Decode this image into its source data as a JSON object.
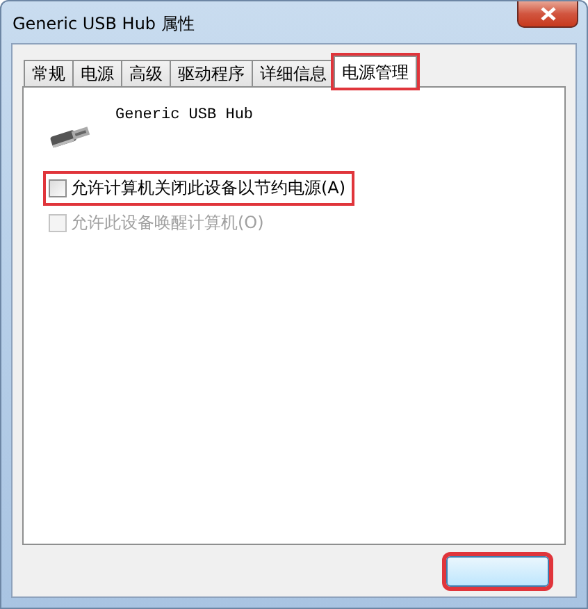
{
  "window": {
    "title": "Generic USB Hub 属性"
  },
  "tabs": [
    {
      "label": "常规",
      "selected": false,
      "highlighted": false
    },
    {
      "label": "电源",
      "selected": false,
      "highlighted": false
    },
    {
      "label": "高级",
      "selected": false,
      "highlighted": false
    },
    {
      "label": "驱动程序",
      "selected": false,
      "highlighted": false
    },
    {
      "label": "详细信息",
      "selected": false,
      "highlighted": false
    },
    {
      "label": "电源管理",
      "selected": true,
      "highlighted": true
    }
  ],
  "device": {
    "name": "Generic USB Hub"
  },
  "options": [
    {
      "label": "允许计算机关闭此设备以节约电源(A)",
      "checked": false,
      "disabled": false,
      "highlighted": true
    },
    {
      "label": "允许此设备唤醒计算机(O)",
      "checked": false,
      "disabled": true,
      "highlighted": false
    }
  ],
  "footer": {
    "button_highlighted": true
  }
}
